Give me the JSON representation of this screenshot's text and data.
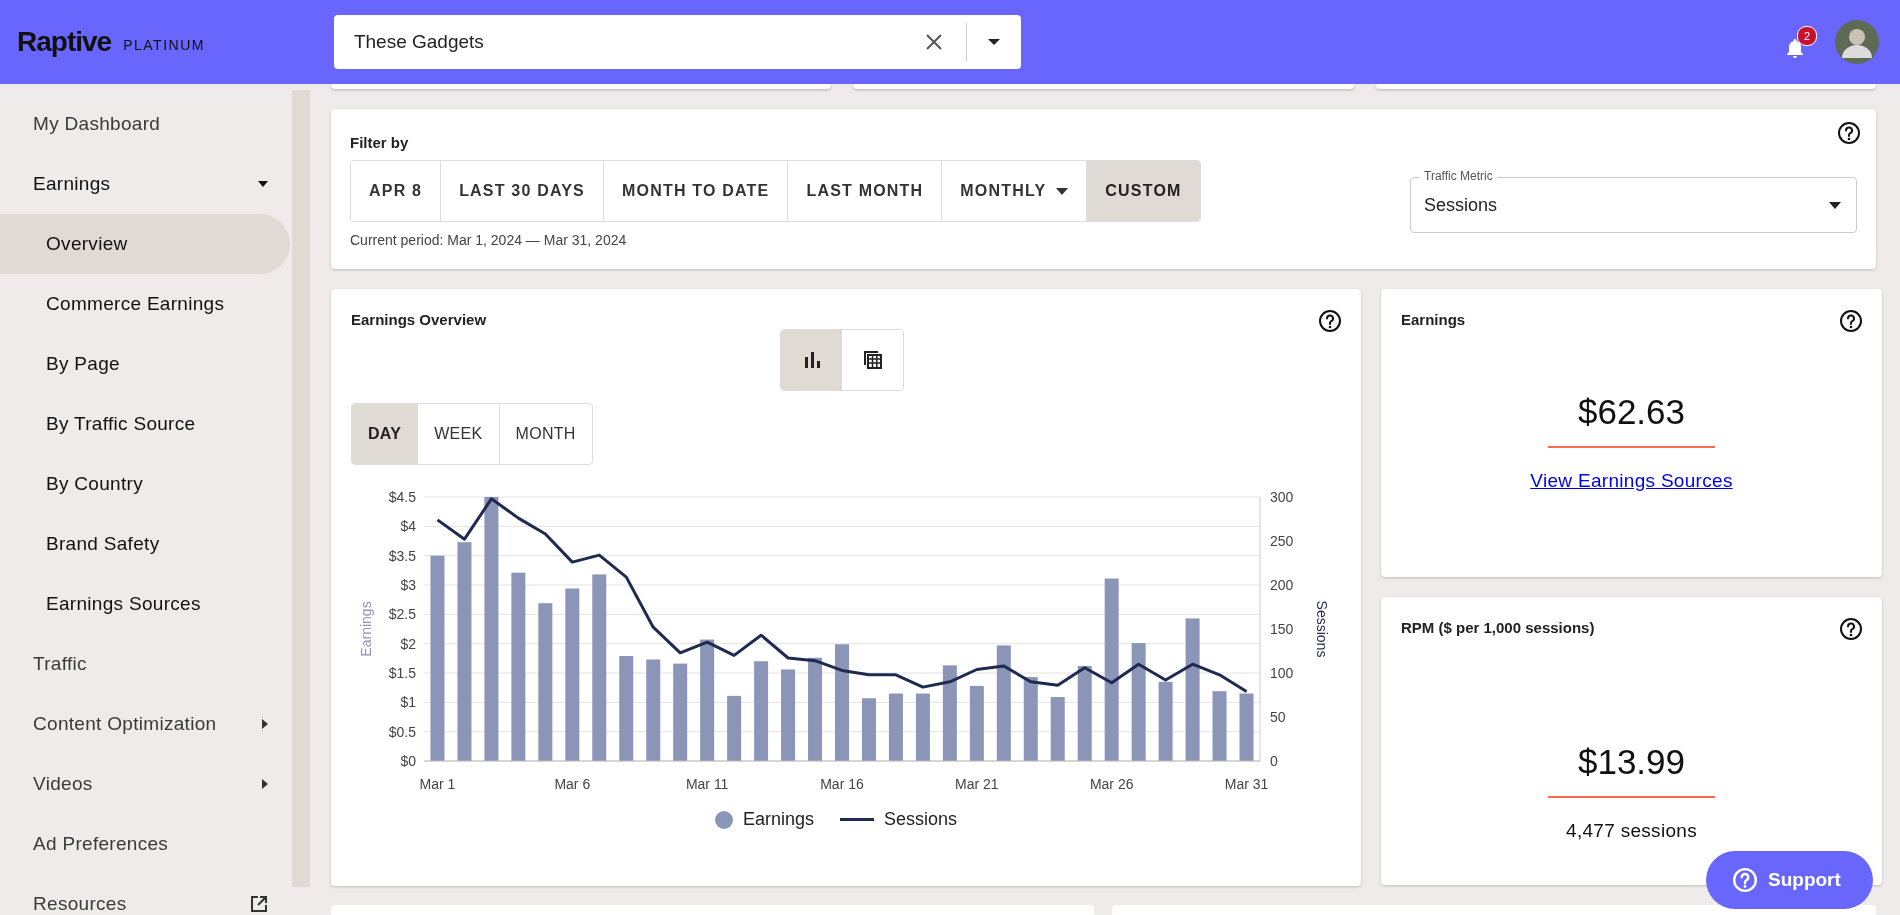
{
  "header": {
    "logo": "Raptive",
    "tier": "PLATINUM",
    "site_select": {
      "value": "These Gadgets"
    },
    "notifications": "2"
  },
  "sidebar": {
    "items": [
      {
        "label": "My Dashboard",
        "kind": "link",
        "selected": false
      },
      {
        "label": "Earnings",
        "kind": "group",
        "expanded": true,
        "selected": false,
        "children": [
          {
            "label": "Overview",
            "selected": true
          },
          {
            "label": "Commerce Earnings",
            "selected": false
          },
          {
            "label": "By Page",
            "selected": false
          },
          {
            "label": "By Traffic Source",
            "selected": false
          },
          {
            "label": "By Country",
            "selected": false
          },
          {
            "label": "Brand Safety",
            "selected": false
          },
          {
            "label": "Earnings Sources",
            "selected": false
          }
        ]
      },
      {
        "label": "Traffic",
        "kind": "link",
        "selected": false
      },
      {
        "label": "Content Optimization",
        "kind": "group",
        "expanded": false,
        "selected": false
      },
      {
        "label": "Videos",
        "kind": "group",
        "expanded": false,
        "selected": false
      },
      {
        "label": "Ad Preferences",
        "kind": "link",
        "selected": false
      },
      {
        "label": "Resources",
        "kind": "external",
        "selected": false
      }
    ]
  },
  "filter": {
    "label": "Filter by",
    "options": [
      {
        "label": "APR 8",
        "kind": "button",
        "selected": false
      },
      {
        "label": "LAST 30 DAYS",
        "kind": "button",
        "selected": false
      },
      {
        "label": "MONTH TO DATE",
        "kind": "button",
        "selected": false
      },
      {
        "label": "LAST MONTH",
        "kind": "button",
        "selected": false
      },
      {
        "label": "MONTHLY",
        "kind": "dropdown",
        "selected": false
      },
      {
        "label": "CUSTOM",
        "kind": "button",
        "selected": true
      }
    ],
    "period": "Current period: Mar 1, 2024 — Mar 31, 2024",
    "traffic_metric": {
      "label": "Traffic Metric",
      "value": "Sessions"
    }
  },
  "earnings_overview": {
    "title": "Earnings Overview",
    "view_toggle": [
      {
        "kind": "chart",
        "selected": true
      },
      {
        "kind": "table",
        "selected": false
      }
    ],
    "granularity": [
      {
        "label": "DAY",
        "selected": true
      },
      {
        "label": "WEEK",
        "selected": false
      },
      {
        "label": "MONTH",
        "selected": false
      }
    ],
    "chart_data": {
      "type": "bar",
      "grid": true,
      "ylabel": "Earnings",
      "y2label": "Sessions",
      "categories": [
        "Mar 1",
        null,
        null,
        null,
        null,
        "Mar 6",
        null,
        null,
        null,
        null,
        "Mar 11",
        null,
        null,
        null,
        null,
        "Mar 16",
        null,
        null,
        null,
        null,
        "Mar 21",
        null,
        null,
        null,
        null,
        "Mar 26",
        null,
        null,
        null,
        null,
        "Mar 31"
      ],
      "ylim": [
        0,
        4.5
      ],
      "yticks": [
        {
          "value": 0,
          "label": "$0"
        },
        {
          "value": 0.5,
          "label": "$0.5"
        },
        {
          "value": 1,
          "label": "$1"
        },
        {
          "value": 1.5,
          "label": "$1.5"
        },
        {
          "value": 2,
          "label": "$2"
        },
        {
          "value": 2.5,
          "label": "$2.5"
        },
        {
          "value": 3,
          "label": "$3"
        },
        {
          "value": 3.5,
          "label": "$3.5"
        },
        {
          "value": 4,
          "label": "$4"
        },
        {
          "value": 4.5,
          "label": "$4.5"
        }
      ],
      "y2lim": [
        0,
        300
      ],
      "y2ticks": [
        0,
        50,
        100,
        150,
        200,
        250,
        300
      ],
      "series": [
        {
          "name": "Earnings",
          "type": "bar",
          "color": "#8a95b8",
          "values": [
            3.5,
            3.73,
            4.5,
            3.21,
            2.69,
            2.94,
            3.18,
            1.79,
            1.73,
            1.66,
            2.07,
            1.11,
            1.7,
            1.56,
            1.76,
            1.99,
            1.07,
            1.15,
            1.15,
            1.63,
            1.28,
            1.97,
            1.43,
            1.09,
            1.62,
            3.11,
            2.01,
            1.35,
            2.43,
            1.19,
            1.15
          ]
        },
        {
          "name": "Sessions",
          "type": "line",
          "axis": "y2",
          "color": "#1e2a4f",
          "values": [
            274,
            252,
            298,
            276,
            258,
            226,
            234,
            209,
            152,
            123,
            135,
            120,
            143,
            117,
            114,
            103,
            98,
            98,
            84,
            90,
            104,
            108,
            90,
            86,
            106,
            89,
            110,
            92,
            110,
            98,
            79
          ]
        }
      ]
    }
  },
  "stat_cards": [
    {
      "title": "Earnings",
      "value": "$62.63",
      "link": "View Earnings Sources"
    },
    {
      "title": "RPM ($ per 1,000 sessions)",
      "value": "$13.99",
      "note": "4,477 sessions"
    }
  ],
  "support_button": {
    "label": "Support"
  }
}
